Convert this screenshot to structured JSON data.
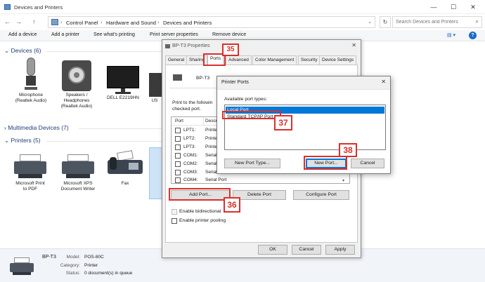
{
  "window": {
    "title": "Devices and Printers",
    "controls": {
      "minimize": "—",
      "maximize": "☐",
      "close": "✕"
    }
  },
  "nav": {
    "back": "←",
    "forward": "→",
    "up": "↑"
  },
  "address": {
    "crumbs": [
      "Control Panel",
      "Hardware and Sound",
      "Devices and Printers"
    ],
    "separator": "›",
    "dropdown": "⌄",
    "refresh": "↻"
  },
  "search": {
    "placeholder": "Search Devices and Printers",
    "icon": "⌕"
  },
  "toolbar": {
    "add_device": "Add a device",
    "add_printer": "Add a printer",
    "whats_printing": "See what's printing",
    "server_properties": "Print server properties",
    "remove_device": "Remove device",
    "view": "▤ ▾",
    "help": "?"
  },
  "sections": {
    "devices": "Devices (6)",
    "multimedia": "Multimedia Devices (7)",
    "printers": "Printers (5)",
    "chevron": "⌄",
    "collapsed_chevron": "›"
  },
  "devices": [
    {
      "line1": "Microphone",
      "line2": "(Realtek Audio)",
      "line3": ""
    },
    {
      "line1": "Speakers /",
      "line2": "Headphones",
      "line3": "(Realtek Audio)"
    },
    {
      "line1": "DELL E2219HN",
      "line2": "",
      "line3": ""
    },
    {
      "line1": "US",
      "line2": "",
      "line3": ""
    }
  ],
  "printers": [
    {
      "line1": "Microsoft Print",
      "line2": "to PDF"
    },
    {
      "line1": "Microsoft XPS",
      "line2": "Document Writer"
    },
    {
      "line1": "Fax",
      "line2": ""
    }
  ],
  "status": {
    "name": "BP-T3",
    "model_label": "Model:",
    "model": "POS-80C",
    "category_label": "Category:",
    "category": "Printer",
    "status_label": "Status:",
    "status": "0 document(s) in queue"
  },
  "properties": {
    "title": "BP-T3 Properties",
    "close": "✕",
    "tabs": [
      "General",
      "Sharing",
      "Ports",
      "Advanced",
      "Color Management",
      "Security",
      "Device Settings"
    ],
    "printer_name": "BP-T3",
    "print_to_line1": "Print to the followin",
    "print_to_line2": "checked port.",
    "port_header": "Port",
    "desc_header": "Descr",
    "ports": [
      {
        "port": "LPT1:",
        "desc": "Printe"
      },
      {
        "port": "LPT2:",
        "desc": "Printe"
      },
      {
        "port": "LPT3:",
        "desc": "Printe"
      },
      {
        "port": "COM1:",
        "desc": "Serial"
      },
      {
        "port": "COM2:",
        "desc": "Serial"
      },
      {
        "port": "COM3:",
        "desc": "Serial"
      },
      {
        "port": "COM4:",
        "desc": "Serial Port"
      }
    ],
    "scroll_down": "▾",
    "add_port": "Add Port...",
    "delete_port": "Delete Port",
    "configure_port": "Configure Port",
    "bidirectional": "Enable bidirectional",
    "pooling": "Enable printer pooling",
    "ok": "OK",
    "cancel": "Cancel",
    "apply": "Apply"
  },
  "printer_ports": {
    "title": "Printer Ports",
    "close": "✕",
    "available_label": "Available port types:",
    "types": [
      "Local Port",
      "Standard TCP/IP Port"
    ],
    "selected_index": 0,
    "new_port_type": "New Port Type...",
    "new_port": "New Port...",
    "cancel": "Cancel"
  },
  "markers": {
    "step35": "35",
    "step36": "36",
    "step37": "37",
    "step38": "38"
  },
  "colors": {
    "accent": "#0078d7",
    "marker_red": "#d9302c",
    "section_blue": "#1e3f75",
    "status_bg": "#f1f4f9"
  }
}
